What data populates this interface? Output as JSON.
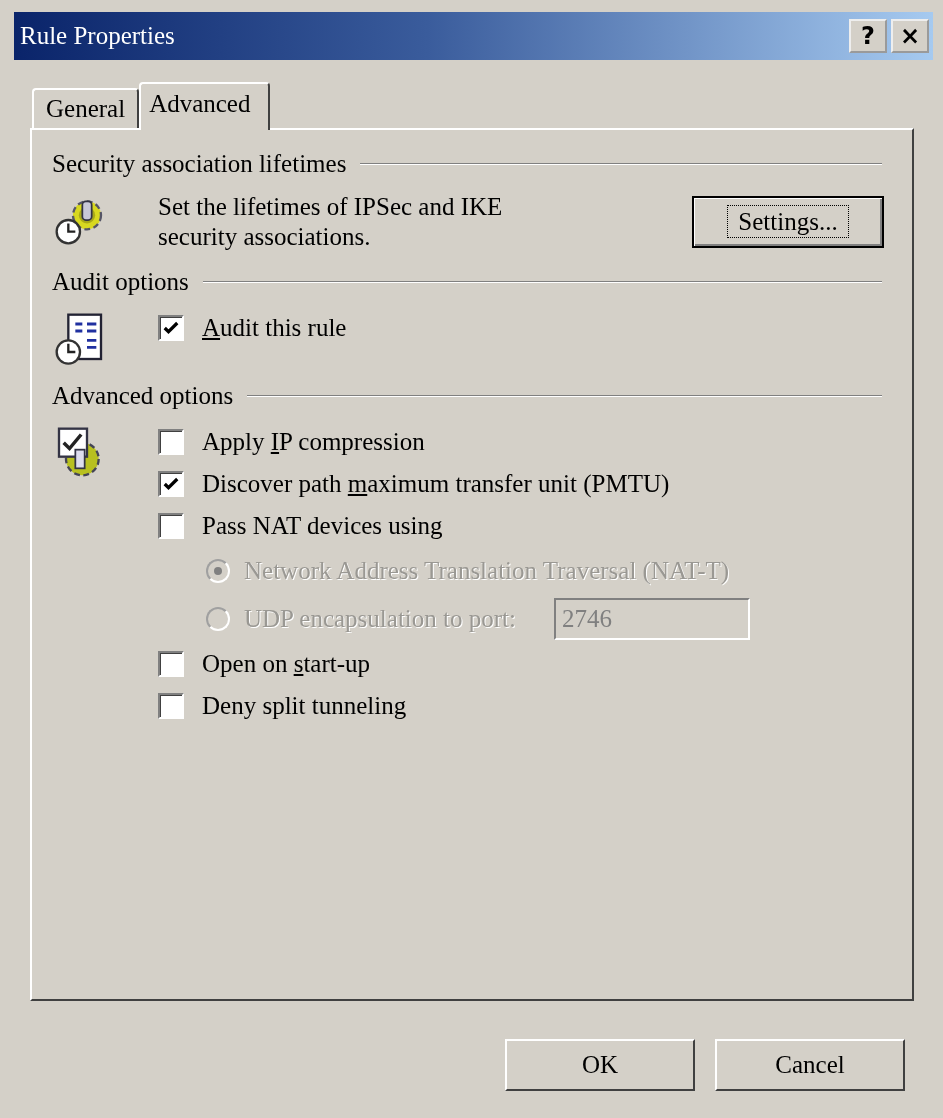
{
  "window": {
    "title": "Rule Properties",
    "buttons": [
      "?",
      "×"
    ]
  },
  "tabs": [
    {
      "label": "General",
      "selected": false
    },
    {
      "label": "Advanced",
      "selected": true
    }
  ],
  "sections": [
    {
      "kind": "lifetimes",
      "title": "Security association lifetimes",
      "description_lines": [
        "Set the lifetimes of IPSec and IKE",
        "security associations."
      ],
      "button": "Settings..."
    },
    {
      "kind": "audit",
      "title": "Audit options",
      "options": [
        {
          "kind": "checkbox",
          "label_parts": [
            {
              "text": "A",
              "underlined": true
            },
            {
              "text": "udit this rule",
              "underlined": false
            }
          ],
          "checked": true
        }
      ]
    },
    {
      "kind": "advanced",
      "title": "Advanced options",
      "options": [
        {
          "kind": "checkbox",
          "label_parts": [
            {
              "text": "Apply ",
              "underlined": false
            },
            {
              "text": "I",
              "underlined": true
            },
            {
              "text": "P compression",
              "underlined": false
            }
          ],
          "checked": false
        },
        {
          "kind": "checkbox",
          "label_parts": [
            {
              "text": "Discover path ",
              "underlined": false
            },
            {
              "text": "m",
              "underlined": true
            },
            {
              "text": "aximum transfer unit (PMTU)",
              "underlined": false
            }
          ],
          "checked": true
        },
        {
          "kind": "checkbox",
          "label_parts": [
            {
              "text": "Pass NAT devices using",
              "underlined": false
            }
          ],
          "checked": false
        },
        {
          "kind": "radio",
          "label": "Network Address Translation Traversal (NAT-T)",
          "selected": true,
          "disabled": true
        },
        {
          "kind": "radio",
          "label": "UDP encapsulation to port:",
          "selected": false,
          "disabled": true,
          "value": "2746"
        },
        {
          "kind": "checkbox",
          "label_parts": [
            {
              "text": "Open on ",
              "underlined": false
            },
            {
              "text": "s",
              "underlined": true
            },
            {
              "text": "tart-up",
              "underlined": false
            }
          ],
          "checked": false
        },
        {
          "kind": "checkbox",
          "label_parts": [
            {
              "text": "Deny split tunneling",
              "underlined": false
            }
          ],
          "checked": false
        }
      ]
    }
  ],
  "buttons": [
    "OK",
    "Cancel"
  ]
}
